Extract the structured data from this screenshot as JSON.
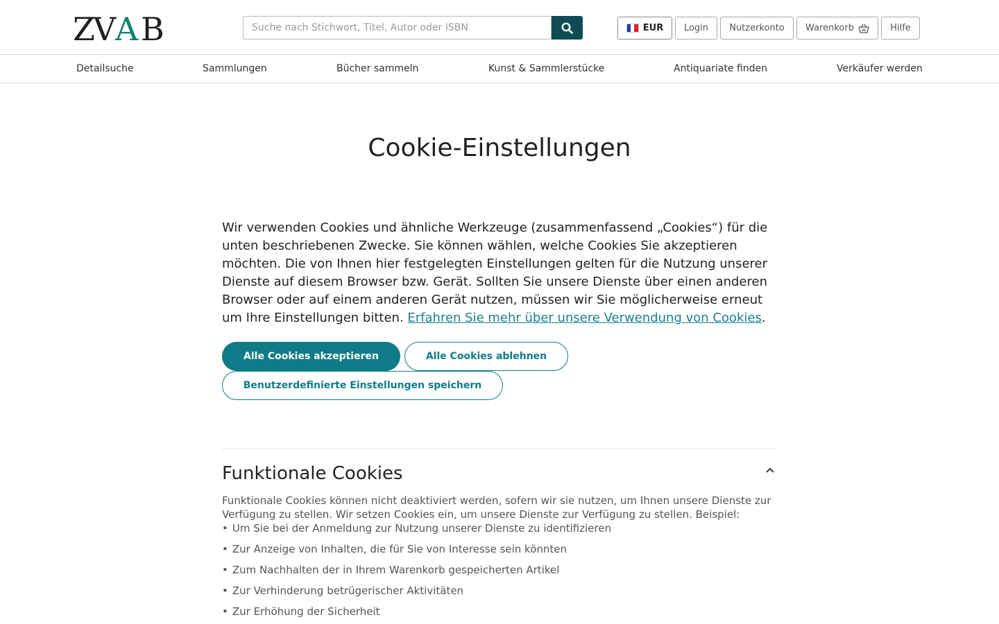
{
  "header": {
    "logo_text": "ZVAB",
    "search": {
      "placeholder": "Suche nach Stichwort, Titel, Autor oder ISBN",
      "value": "",
      "icon": "search-icon"
    },
    "currency": {
      "label": "EUR",
      "flag": "france-flag"
    },
    "login_label": "Login",
    "account_label": "Nutzerkonto",
    "cart": {
      "label": "Warenkorb",
      "icon": "basket-icon"
    },
    "help_label": "Hilfe"
  },
  "nav": {
    "items": [
      "Detailsuche",
      "Sammlungen",
      "Bücher sammeln",
      "Kunst & Sammlerstücke",
      "Antiquariate finden",
      "Verkäufer werden"
    ]
  },
  "main": {
    "title": "Cookie-Einstellungen",
    "intro_text": "Wir verwenden Cookies und ähnliche Werkzeuge (zusammenfassend „Cookies“) für die unten beschriebenen Zwecke. Sie können wählen, welche Cookies Sie akzeptieren möchten. Die von Ihnen hier festgelegten Einstellungen gelten für die Nutzung unserer Dienste auf diesem Browser bzw. Gerät. Sollten Sie unsere Dienste über einen anderen Browser oder auf einem anderen Gerät nutzen, müssen wir Sie möglicherweise erneut um Ihre Einstellungen bitten.",
    "intro_link": "Erfahren Sie mehr über unsere Verwendung von Cookies",
    "intro_end": ".",
    "buttons": {
      "accept_all": "Alle Cookies akzeptieren",
      "decline_all": "Alle Cookies ablehnen",
      "save_custom": "Benutzerdefinierte Einstellungen speichern"
    },
    "functional": {
      "title": "Funktionale Cookies",
      "description": "Funktionale Cookies können nicht deaktiviert werden, sofern wir sie nutzen, um Ihnen unsere Dienste zur Verfügung zu stellen. Wir setzen Cookies ein, um unsere Dienste zur Verfügung zu stellen. Beispiel:",
      "items": [
        "Um Sie bei der Anmeldung zur Nutzung unserer Dienste zu identifizieren",
        "Zur Anzeige von Inhalten, die für Sie von Interesse sein könnten",
        "Zum Nachhalten der in Ihrem Warenkorb gespeicherten Artikel",
        "Zur Verhinderung betrügerischer Aktivitäten",
        "Zur Erhöhung der Sicherheit"
      ]
    }
  },
  "colors": {
    "accent": "#0e7c88",
    "search_button": "#0e4d56",
    "logo_dark": "#1f1f1f",
    "logo_accent": "#12806f"
  }
}
